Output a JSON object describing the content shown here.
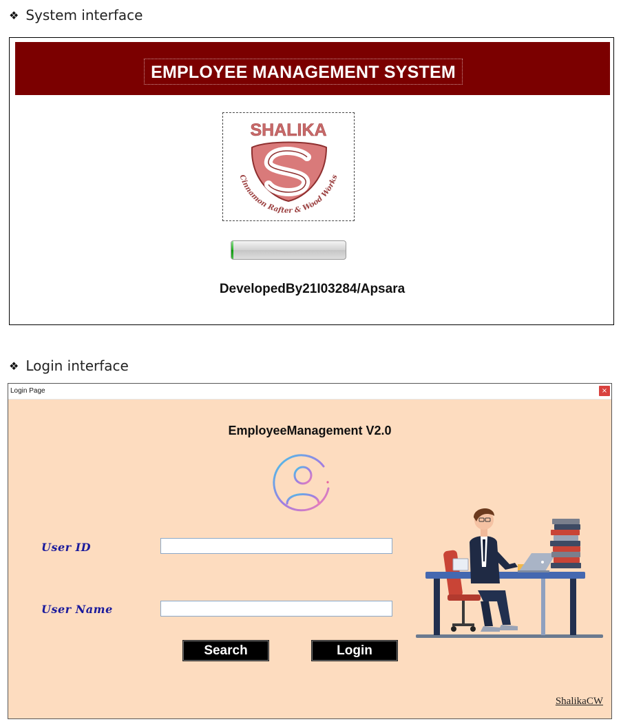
{
  "sections": {
    "system_heading": "System interface",
    "login_heading": "Login interface"
  },
  "splash": {
    "title": "EMPLOYEE MANAGEMENT SYSTEM",
    "logo": {
      "name": "SHALIKA",
      "tagline": "Cinnamon Rafter & Wood Works"
    },
    "progress": 0.02,
    "developer": "DevelopedBy21I03284/Apsara",
    "colors": {
      "header": "#7b0000"
    }
  },
  "login": {
    "window_title": "Login Page",
    "close_glyph": "×",
    "app_title": "EmployeeManagement V2.0",
    "user_id_label": "User ID",
    "user_id_value": "",
    "user_name_label": "User Name",
    "user_name_value": "",
    "search_label": "Search",
    "login_label": "Login",
    "watermark": "ShalikaCW",
    "icons": {
      "avatar": "user-circle-icon",
      "illustration": "employee-at-desk-illustration"
    },
    "colors": {
      "background": "#fddcbf",
      "label": "#1a1a9c"
    }
  }
}
